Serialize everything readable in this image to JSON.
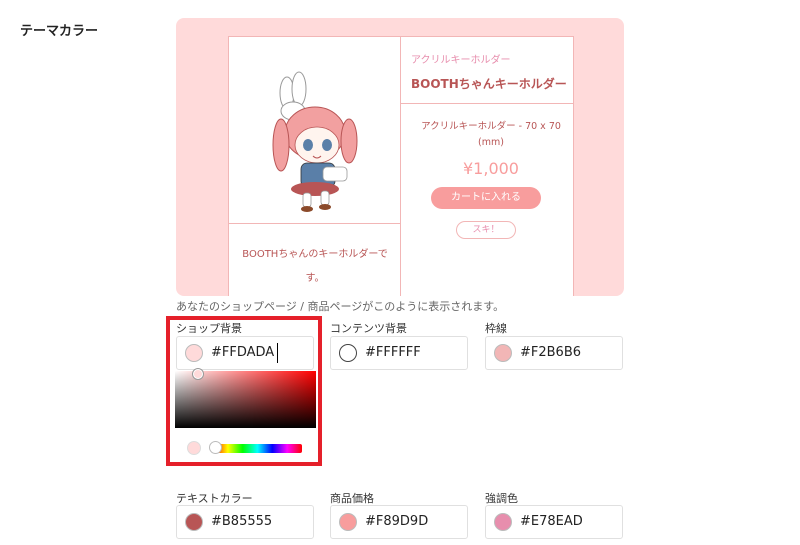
{
  "section_title": "テーマカラー",
  "preview": {
    "category": "アクリルキーホルダー",
    "product_name": "BOOTHちゃんキーホルダー",
    "variant_line1": "アクリルキーホルダー - 70 x 70",
    "variant_line2": "(mm)",
    "price": "¥1,000",
    "cart_button": "カートに入れる",
    "like_button": "スキ！",
    "description_line1": "BOOTHちゃんのキーホルダーで",
    "description_line2": "す。"
  },
  "preview_caption": "あなたのショップページ / 商品ページがこのように表示されます。",
  "fields": {
    "shop_bg": {
      "label": "ショップ背景",
      "value": "#FFDADA",
      "color": "#FFDADA"
    },
    "content_bg": {
      "label": "コンテンツ背景",
      "value": "#FFFFFF",
      "color": "#FFFFFF"
    },
    "border": {
      "label": "枠線",
      "value": "#F2B6B6",
      "color": "#F2B6B6"
    },
    "text": {
      "label": "テキストカラー",
      "value": "#B85555",
      "color": "#B85555"
    },
    "price": {
      "label": "商品価格",
      "value": "#F89D9D",
      "color": "#F89D9D"
    },
    "accent": {
      "label": "強調色",
      "value": "#E78EAD",
      "color": "#E78EAD"
    }
  },
  "picker": {
    "hue": 0
  },
  "colors": {
    "highlight": "#E5202A"
  }
}
